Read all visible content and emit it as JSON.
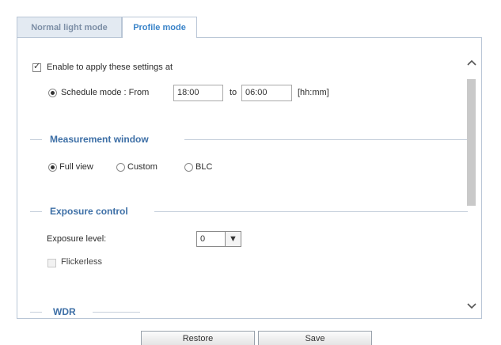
{
  "tabs": [
    {
      "label": "Normal light mode",
      "active": false
    },
    {
      "label": "Profile mode",
      "active": true
    }
  ],
  "apply": {
    "checkbox_label": "Enable to apply these settings at",
    "checked": true,
    "schedule_label": "Schedule mode : From",
    "from_value": "18:00",
    "to_label": "to",
    "to_value": "06:00",
    "format_hint": "[hh:mm]"
  },
  "measurement": {
    "title": "Measurement window",
    "options": [
      "Full view",
      "Custom",
      "BLC"
    ],
    "selected": "Full view"
  },
  "exposure": {
    "title": "Exposure control",
    "level_label": "Exposure level:",
    "level_value": "0",
    "flickerless_label": "Flickerless",
    "flickerless_checked": false
  },
  "wdr": {
    "title": "WDR"
  },
  "buttons": {
    "restore": "Restore",
    "save": "Save"
  },
  "icons": {
    "scroll_up": "chevron-up-icon",
    "scroll_down": "chevron-down-icon",
    "select_arrow": "chevron-down-icon"
  },
  "colors": {
    "active_tab_text": "#3a84c9",
    "section_title": "#3d6fa6",
    "border": "#b9c6d6"
  }
}
